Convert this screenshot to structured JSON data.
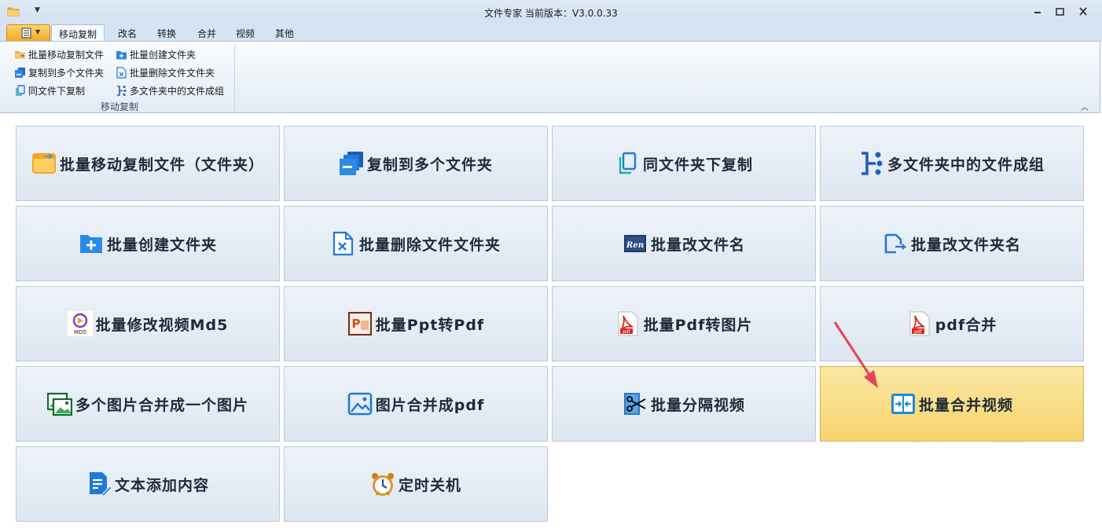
{
  "window": {
    "title": "文件专家   当前版本：V3.0.0.33"
  },
  "tabs": [
    "移动复制",
    "改名",
    "转换",
    "合并",
    "视频",
    "其他"
  ],
  "ribbon": {
    "items": [
      "批量移动复制文件",
      "复制到多个文件夹",
      "同文件下复制",
      "批量创建文件夹",
      "批量删除文件文件夹",
      "多文件夹中的文件成组"
    ],
    "group_label": "移动复制"
  },
  "tiles": [
    {
      "label": "批量移动复制文件（文件夹）",
      "icon": "folder-move-icon"
    },
    {
      "label": "复制到多个文件夹",
      "icon": "copy-multi-icon"
    },
    {
      "label": "同文件夹下复制",
      "icon": "copy-same-icon"
    },
    {
      "label": "多文件夹中的文件成组",
      "icon": "group-files-icon"
    },
    {
      "label": "批量创建文件夹",
      "icon": "create-folder-icon"
    },
    {
      "label": "批量删除文件文件夹",
      "icon": "delete-file-icon"
    },
    {
      "label": "批量改文件名",
      "icon": "rename-icon"
    },
    {
      "label": "批量改文件夹名",
      "icon": "rename-folder-icon"
    },
    {
      "label": "批量修改视频Md5",
      "icon": "md5-icon"
    },
    {
      "label": "批量Ppt转Pdf",
      "icon": "ppt-icon"
    },
    {
      "label": "批量Pdf转图片",
      "icon": "pdf-icon"
    },
    {
      "label": "pdf合并",
      "icon": "pdf-icon"
    },
    {
      "label": "多个图片合并成一个图片",
      "icon": "image-merge-icon"
    },
    {
      "label": "图片合并成pdf",
      "icon": "image-icon"
    },
    {
      "label": "批量分隔视频",
      "icon": "scissors-icon"
    },
    {
      "label": "批量合并视频",
      "icon": "merge-video-icon"
    },
    {
      "label": "文本添加内容",
      "icon": "text-edit-icon"
    },
    {
      "label": "定时关机",
      "icon": "alarm-clock-icon"
    }
  ],
  "selected_tile": "批量合并视频",
  "colors": {
    "accent": "#1f7ad8",
    "highlight": "#f7d36d",
    "annotation_arrow": "#e8435a"
  }
}
